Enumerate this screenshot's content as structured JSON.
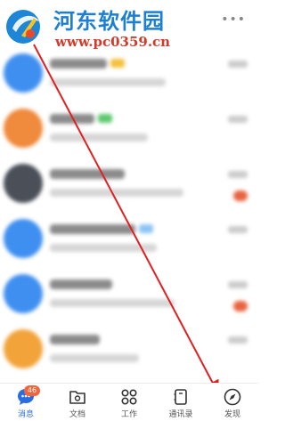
{
  "watermark": {
    "title": "河东软件园",
    "url": "www.pc0359.cn"
  },
  "header": {
    "more_icon": "more-dots-icon"
  },
  "chat_list": {
    "items": [
      {
        "avatar_color": "#3f8ff0",
        "tag_color": "#f4c13c"
      },
      {
        "avatar_color": "#f08a3c",
        "tag_color": "#5cc96f"
      },
      {
        "avatar_color": "#4a4f58",
        "tag_color": null
      },
      {
        "avatar_color": "#3f8ff0",
        "tag_color": "#8cc4f5"
      },
      {
        "avatar_color": "#3f8ff0",
        "tag_color": null
      },
      {
        "avatar_color": "#f2a43a",
        "tag_color": null
      },
      {
        "avatar_color": "#3f8ff0",
        "tag_color": null
      }
    ]
  },
  "bottom_nav": {
    "messages": {
      "label": "消息",
      "badge": "46",
      "icon": "chat-bubble-icon"
    },
    "docs": {
      "label": "文档",
      "icon": "document-folder-icon"
    },
    "work": {
      "label": "工作",
      "icon": "grid-apps-icon"
    },
    "contacts": {
      "label": "通讯录",
      "icon": "contacts-book-icon"
    },
    "discover": {
      "label": "发现",
      "icon": "compass-icon"
    }
  },
  "colors": {
    "accent": "#2a6de0",
    "badge": "#f0653a",
    "annotation_arrow": "#e02020"
  }
}
